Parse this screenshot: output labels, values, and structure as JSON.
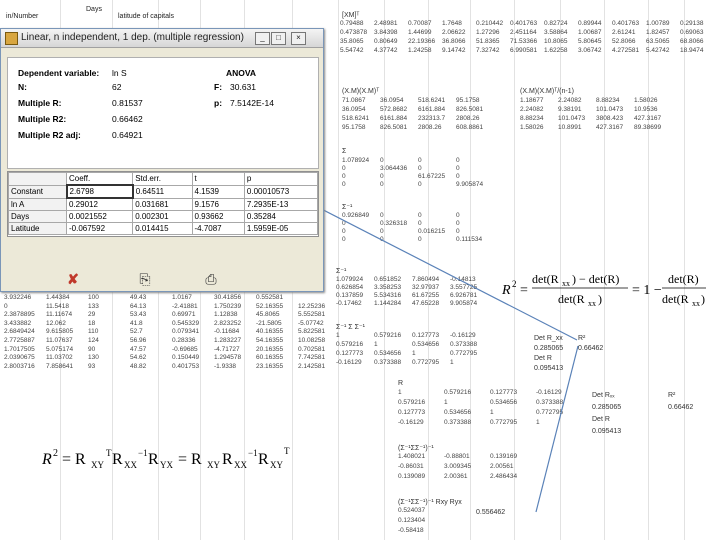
{
  "sheet": {
    "col_headers": [
      "in/Number",
      "Days",
      "latitude of capitals"
    ],
    "left_rows": [
      [
        "3.932246",
        "1.44384",
        "100",
        "49.43",
        "1.0167",
        "30.41856",
        "0.552581"
      ],
      [
        "0",
        "11.5418",
        "133",
        "64.13",
        "-2.41881",
        "1.750239",
        "52.16355",
        "12.25236"
      ],
      [
        "2.3878895",
        "11.11674",
        "29",
        "53.43",
        "0.69971",
        "1.12838",
        "45.8065",
        "5.552581"
      ],
      [
        "3.433882",
        "12.062",
        "18",
        "41.8",
        "0.545329",
        "2.823252",
        "-21.5805",
        "-5.07742"
      ],
      [
        "2.6849424",
        "9.615805",
        "110",
        "52.7",
        "0.079341",
        "-0.11684",
        "40.16355",
        "5.822581"
      ],
      [
        "2.7725887",
        "11.07637",
        "124",
        "56.96",
        "0.28336",
        "1.283227",
        "54.16355",
        "10.08258"
      ],
      [
        "1.7017505",
        "5.075174",
        "90",
        "47.57",
        "-0.69685",
        "-4.71727",
        "20.16355",
        "0.702581"
      ],
      [
        "2.0390675",
        "11.03702",
        "130",
        "54.62",
        "0.150449",
        "1.294578",
        "60.16355",
        "7.742581"
      ],
      [
        "2.8003716",
        "7.858641",
        "93",
        "48.82",
        "0.401753",
        "-1.9338",
        "23.16355",
        "2.142581"
      ]
    ],
    "xm_label": "[XM]ᵀ",
    "xm_rows": [
      [
        "0.79488",
        "2.48981",
        "0.70087",
        "1.7648",
        "0.210442",
        "0.401763",
        "0.82724",
        "0.89944",
        "0.401763",
        "1.00789",
        "0.29138"
      ],
      [
        "0.473878",
        "3.84398",
        "1.44699",
        "2.06622",
        "1.27296",
        "2.451164",
        "3.58864",
        "1.00687",
        "2.61241",
        "1.82457",
        "0.69063"
      ],
      [
        "35.8065",
        "0.80649",
        "22.19366",
        "36.8066",
        "51.8365",
        "71.53366",
        "10.8065",
        "5.80645",
        "52.8066",
        "63.5065",
        "68.8066"
      ],
      [
        "5.54742",
        "4.37742",
        "1.24258",
        "9.14742",
        "7.32742",
        "6.990581",
        "1.62258",
        "3.06742",
        "4.272581",
        "5.42742",
        "18.9474"
      ]
    ],
    "xmxm_label": "(X.M)(X.M)ᵀ",
    "xmxm_rows": [
      [
        "71.0867",
        "36.0954",
        "518.6241",
        "95.1758"
      ],
      [
        "36.0954",
        "572.8682",
        "6161.884",
        "826.5081"
      ],
      [
        "518.6241",
        "6161.884",
        "232313.7",
        "2808.26"
      ],
      [
        "95.1758",
        "826.5081",
        "2808.26",
        "608.8861"
      ]
    ],
    "xmxm_n1_label": "(X.M)(X.M)ᵀ/(n-1)",
    "xmxm_n1_rows": [
      [
        "1.18677",
        "2.24082",
        "8.88234",
        "1.58026"
      ],
      [
        "2.24082",
        "9.38191",
        "101.0473",
        "10.9536"
      ],
      [
        "8.88234",
        "101.0473",
        "3808.423",
        "427.3167"
      ],
      [
        "1.58026",
        "10.8991",
        "427.3167",
        "89.38699"
      ]
    ],
    "s_label": "Σ",
    "s_rows": [
      [
        "1.078924",
        "0",
        "0",
        "0"
      ],
      [
        "0",
        "3.064436",
        "0",
        "0"
      ],
      [
        "0",
        "0",
        "61.67225",
        "0"
      ],
      [
        "0",
        "0",
        "0",
        "9.905874"
      ]
    ],
    "sinv_label": "Σ⁻¹",
    "sinv_rows": [
      [
        "0.926849",
        "0",
        "0",
        "0"
      ],
      [
        "0",
        "0.326318",
        "0",
        "0"
      ],
      [
        "0",
        "0",
        "0.016215",
        "0"
      ],
      [
        "0",
        "0",
        "0",
        "0.111534"
      ]
    ],
    "sinv2_label": "Σ⁻¹",
    "sinv2_rows": [
      [
        "1.079924",
        "0.651852",
        "7.860494",
        "-0.14813"
      ],
      [
        "0.626854",
        "3.358253",
        "32.97937",
        "3.557725"
      ],
      [
        "0.137859",
        "5.534316",
        "61.67255",
        "6.926781"
      ],
      [
        "-0.17462",
        "1.144284",
        "47.65228",
        "9.905874"
      ]
    ],
    "rxx_label": "Σ⁻¹ Σ Σ⁻¹",
    "rxx_rows": [
      [
        "1",
        "0.579216",
        "0.127773",
        "-0.16129"
      ],
      [
        "0.579216",
        "1",
        "0.534656",
        "0.373388"
      ],
      [
        "0.127773",
        "0.534656",
        "1",
        "0.772795"
      ],
      [
        "-0.16129",
        "0.373388",
        "0.772795",
        "1"
      ]
    ],
    "detrxx_label": "Det R_xx",
    "detrxx_value": "0.285065",
    "detr_label": "Det R",
    "detr_value": "0.095413",
    "r2_label": "R²",
    "r2_value": "0.66462",
    "r_label": "R",
    "r_rows": [
      [
        "1",
        "0.579216",
        "0.127773",
        "-0.16129"
      ],
      [
        "0.579216",
        "1",
        "0.534656",
        "0.373388"
      ],
      [
        "0.127773",
        "0.534656",
        "1",
        "0.772795"
      ],
      [
        "-0.16129",
        "0.373388",
        "0.772795",
        "1"
      ]
    ],
    "r_detrxx_label": "Det Rₓₓ",
    "r_detrxx_value": "0.285065",
    "r_detr_label": "Det R",
    "r_detr_value": "0.095413",
    "r_r2_label": "R²",
    "r_r2_value": "0.66462",
    "rinv_label": "(Σ⁻¹ΣΣ⁻¹)⁻¹",
    "rinv_rows": [
      [
        "1.408021",
        "-0.88801",
        "0.139169"
      ],
      [
        "-0.86031",
        "3.009345",
        "2.00561"
      ],
      [
        "0.139089",
        "2.00361",
        "2.486434"
      ]
    ],
    "rbeta_label": "(Σ⁻¹ΣΣ⁻¹)⁻¹ Rxy Ryx",
    "rbeta_rows": [
      [
        "0.524037"
      ],
      [
        "0.123404"
      ],
      [
        "-0.58418"
      ]
    ],
    "rbeta_result": "0.556462"
  },
  "dialog": {
    "title": "Linear, n independent, 1 dep. (multiple regression)",
    "buttons": {
      "minimize": "_",
      "maximize": "□",
      "close": "×"
    },
    "stats": {
      "dep_label": "Dependent variable:",
      "dep_value": "ln S",
      "anova_label": "ANOVA",
      "n_label": "N:",
      "n_value": "62",
      "f_label": "F:",
      "f_value": "30.631",
      "mr_label": "Multiple R:",
      "mr_value": "0.81537",
      "p_label": "p:",
      "p_value": "7.5142E-14",
      "mr2_label": "Multiple R2:",
      "mr2_value": "0.66462",
      "mr2adj_label": "Multiple R2 adj:",
      "mr2adj_value": "0.64921"
    },
    "table": {
      "headers": [
        "",
        "Coeff.",
        "Std.err.",
        "t",
        "p"
      ],
      "rows": [
        [
          "Constant",
          "2.6798",
          "0.64511",
          "4.1539",
          "0.00010573"
        ],
        [
          "ln A",
          "0.29012",
          "0.031681",
          "9.1576",
          "7.2935E-13"
        ],
        [
          "Days",
          "0.0021552",
          "0.002301",
          "0.93662",
          "0.35284"
        ],
        [
          "Latitude",
          "-0.067592",
          "0.014415",
          "-4.7087",
          "1.5959E-05"
        ]
      ]
    }
  },
  "colors": {
    "dialog_bg": "#ece9d8",
    "connector": "#5a82b8"
  }
}
